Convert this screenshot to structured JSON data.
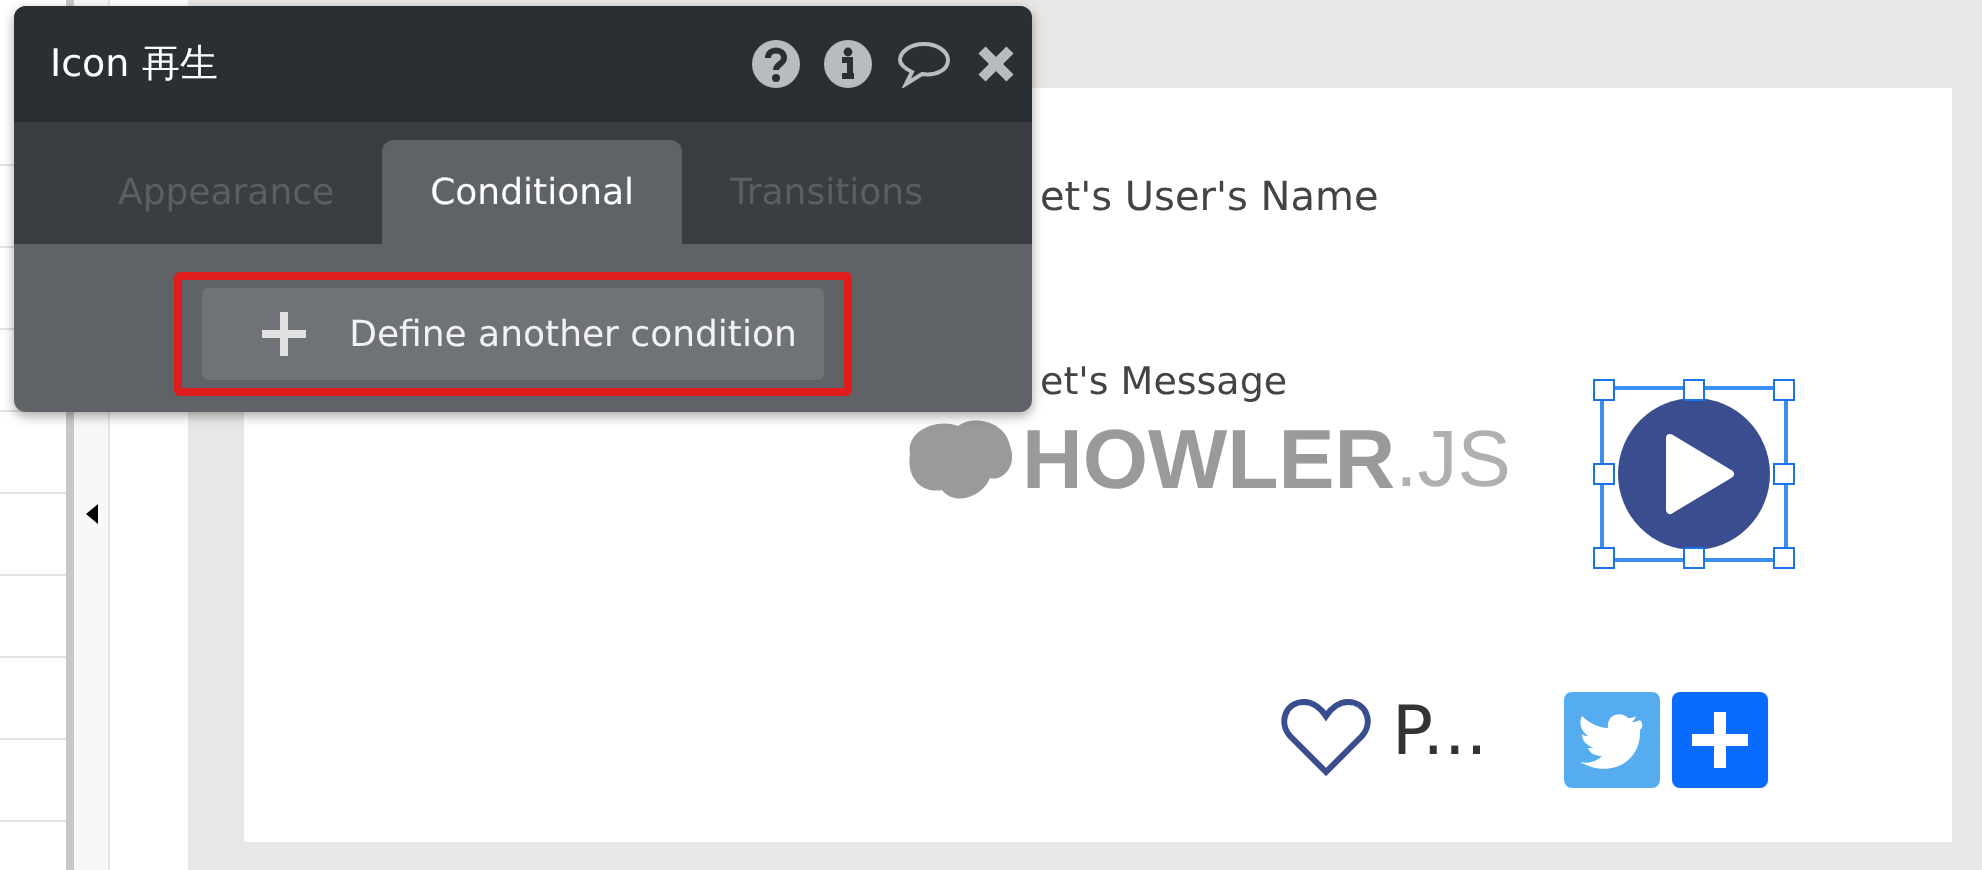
{
  "popup": {
    "title": "Icon 再生",
    "tabs": [
      {
        "label": "Appearance",
        "selected": false
      },
      {
        "label": "Conditional",
        "selected": true
      },
      {
        "label": "Transitions",
        "selected": false
      }
    ],
    "add_button": {
      "label": "Define another condition",
      "highlighted": true
    }
  },
  "canvas": {
    "name_text": "et's User's Name",
    "message_text": "et's Message",
    "logo": {
      "word": "HOWLER",
      "suffix": ".JS"
    },
    "play_icon": {
      "selected": true
    },
    "like_label": "P..."
  }
}
